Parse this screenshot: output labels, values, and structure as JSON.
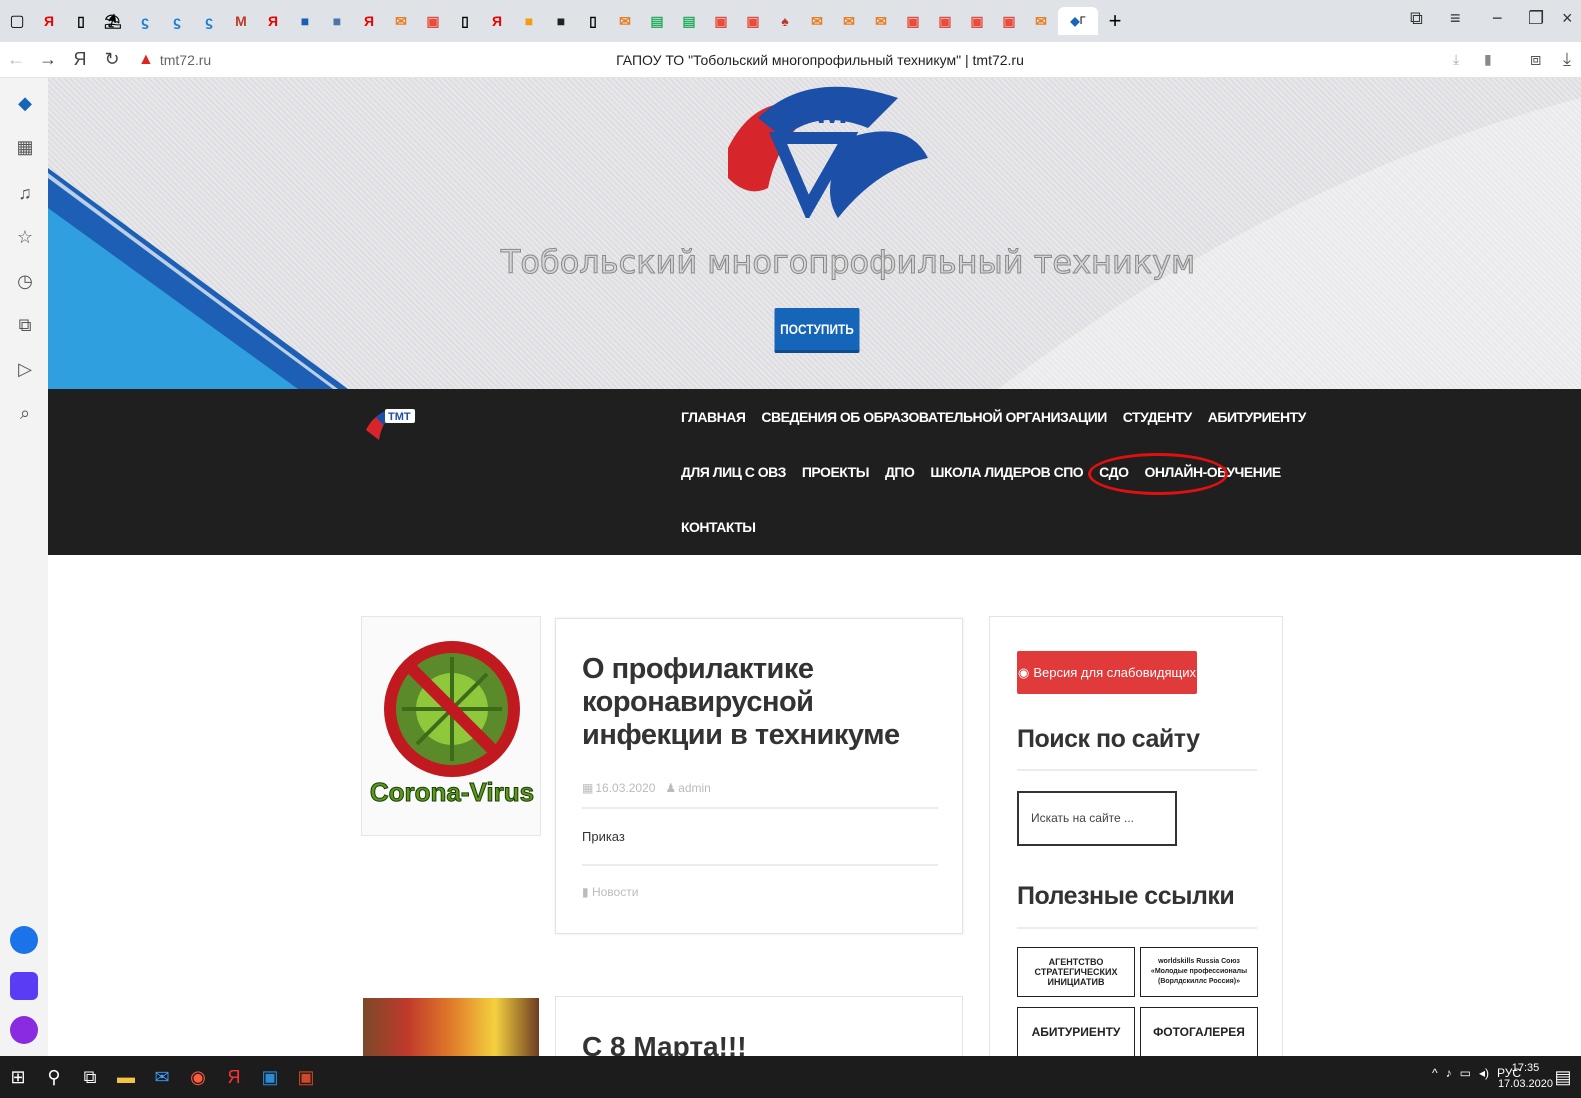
{
  "browser": {
    "tab_title_short": "Г",
    "new_tab": "+",
    "address": "tmt72.ru",
    "page_title": "ГАПОУ ТО \"Тобольский многопрофильный техникум\" | tmt72.ru",
    "yandex_letter": "Я"
  },
  "hero": {
    "logo_text": "ТМТ",
    "site_name": "Тобольский многопрофильный техникум",
    "enroll_button": "ПОСТУПИТЬ"
  },
  "nav": {
    "rows": [
      [
        "ГЛАВНАЯ",
        "СВЕДЕНИЯ ОБ ОБРАЗОВАТЕЛЬНОЙ ОРГАНИЗАЦИИ",
        "СТУДЕНТУ",
        "АБИТУРИЕНТУ"
      ],
      [
        "ДЛЯ ЛИЦ С ОВЗ",
        "ПРОЕКТЫ",
        "ДПО",
        "ШКОЛА ЛИДЕРОВ СПО",
        "СДО",
        "ОНЛАЙН-ОБУЧЕНИЕ"
      ],
      [
        "КОНТАКТЫ"
      ]
    ],
    "highlighted": "ОНЛАЙН-ОБУЧЕНИЕ"
  },
  "posts": [
    {
      "thumb_text": "Corona-Virus",
      "title": "О профилактике коронавирусной инфекции в техникуме",
      "date": "16.03.2020",
      "author": "admin",
      "excerpt": "Приказ",
      "category": "Новости"
    },
    {
      "title": "С 8 Марта!!!"
    }
  ],
  "sidebar": {
    "vision_button": "Версия для слабовидящих",
    "search_heading": "Поиск по сайту",
    "search_placeholder": "Искать на сайте ...",
    "links_heading": "Полезные ссылки",
    "links": [
      "АГЕНТСТВО СТРАТЕГИЧЕСКИХ ИНИЦИАТИВ",
      "worldskills Russia Союз «Молодые профессионалы (Ворлдскиллс Россия)»",
      "АБИТУРИЕНТУ",
      "ФОТОГАЛЕРЕЯ"
    ]
  },
  "taskbar": {
    "lang": "РУС",
    "time": "17:35",
    "date": "17.03.2020"
  },
  "colors": {
    "nav_bg": "#1f1f1f",
    "accent_blue": "#1565b8",
    "vision_red": "#e03a3a",
    "highlight_red": "#e01010"
  }
}
